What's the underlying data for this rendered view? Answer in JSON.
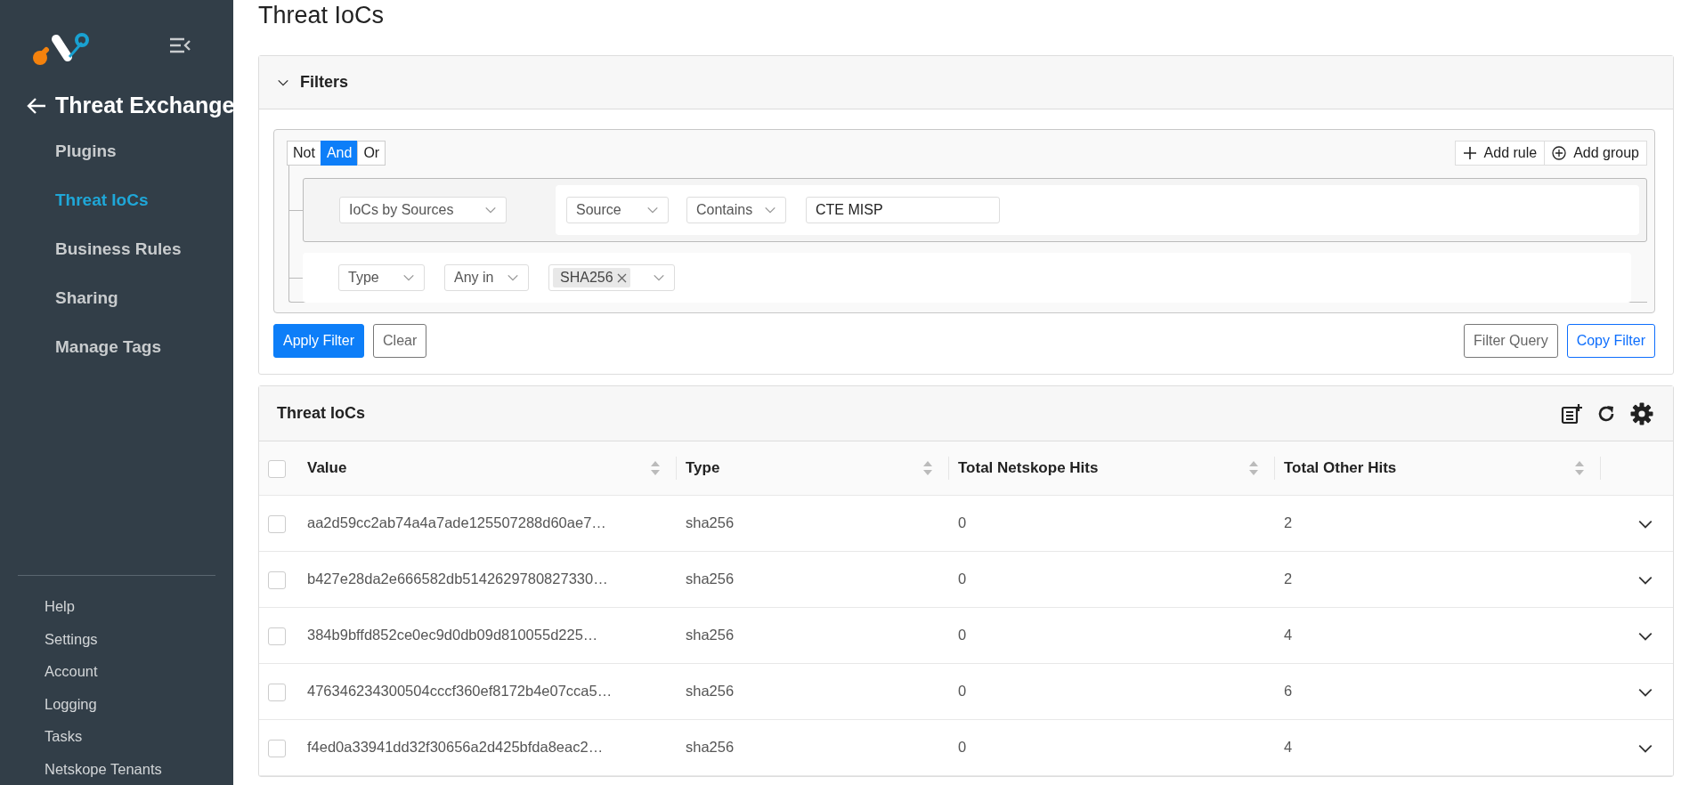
{
  "sidebar": {
    "back_title": "Threat Exchange",
    "items": [
      {
        "label": "Plugins",
        "selected": false
      },
      {
        "label": "Threat IoCs",
        "selected": true
      },
      {
        "label": "Business Rules",
        "selected": false
      },
      {
        "label": "Sharing",
        "selected": false
      },
      {
        "label": "Manage Tags",
        "selected": false
      }
    ],
    "footer_items": [
      "Help",
      "Settings",
      "Account",
      "Logging",
      "Tasks",
      "Netskope Tenants"
    ]
  },
  "page_title": "Threat IoCs",
  "filters": {
    "title": "Filters",
    "expanded": true,
    "conditions": [
      {
        "label": "Not",
        "selected": false
      },
      {
        "label": "And",
        "selected": true
      },
      {
        "label": "Or",
        "selected": false
      }
    ],
    "group_buttons": [
      {
        "kind": "rule",
        "label": "Add rule"
      },
      {
        "kind": "group",
        "label": "Add group"
      }
    ],
    "rules": [
      {
        "kind": "nested",
        "field": "IoCs by Sources",
        "subfield": "Source",
        "operator": "Contains",
        "value": "CTE MISP"
      },
      {
        "kind": "multi",
        "field": "Type",
        "operator": "Any in",
        "tags": [
          "SHA256"
        ]
      }
    ],
    "left_buttons": [
      {
        "kind": "primary",
        "label": "Apply Filter"
      },
      {
        "kind": "secondary",
        "label": "Clear"
      }
    ],
    "right_buttons": [
      {
        "kind": "secondary",
        "label": "Filter Query"
      },
      {
        "kind": "outline-primary",
        "label": "Copy Filter"
      }
    ]
  },
  "table": {
    "title": "Threat IoCs",
    "all_selected": false,
    "columns": [
      {
        "label": "Value",
        "sortable": true
      },
      {
        "label": "Type",
        "sortable": true
      },
      {
        "label": "Total Netskope Hits",
        "sortable": true
      },
      {
        "label": "Total Other Hits",
        "sortable": true
      }
    ],
    "rows": [
      {
        "selected": false,
        "expanded": false,
        "value": "aa2d59cc2ab74a4a7ade125507288d60ae7…",
        "type": "sha256",
        "netskope_hits": "0",
        "other_hits": "2"
      },
      {
        "selected": false,
        "expanded": false,
        "value": "b427e28da2e666582db5142629780827330…",
        "type": "sha256",
        "netskope_hits": "0",
        "other_hits": "2"
      },
      {
        "selected": false,
        "expanded": false,
        "value": "384b9bffd852ce0ec9d0db09d810055d225…",
        "type": "sha256",
        "netskope_hits": "0",
        "other_hits": "4"
      },
      {
        "selected": false,
        "expanded": false,
        "value": "476346234300504cccf360ef8172b4e07cca5…",
        "type": "sha256",
        "netskope_hits": "0",
        "other_hits": "6"
      },
      {
        "selected": false,
        "expanded": false,
        "value": "f4ed0a33941dd32f30656a2d425bfda8eac2…",
        "type": "sha256",
        "netskope_hits": "0",
        "other_hits": "4"
      }
    ]
  }
}
